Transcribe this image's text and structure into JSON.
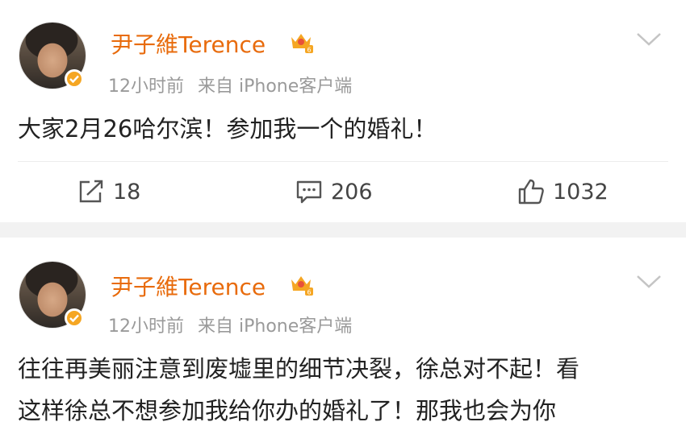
{
  "posts": [
    {
      "author": "尹子維Terence",
      "time": "12小时前",
      "source": "来自 iPhone客户端",
      "content_lines": [
        "大家2月26哈尔滨！参加我一个的婚礼！"
      ],
      "actions": {
        "repost": "18",
        "comment": "206",
        "like": "1032"
      },
      "icons": {
        "repost": "repost-icon",
        "comment": "comment-icon",
        "like": "thumbs-up-icon"
      }
    },
    {
      "author": "尹子維Terence",
      "time": "12小时前",
      "source": "来自 iPhone客户端",
      "content_lines": [
        "往往再美丽注意到废墟里的细节决裂，徐总对不起！看",
        "这样徐总不想参加我给你办的婚礼了！那我也会为你"
      ]
    }
  ],
  "colors": {
    "name": "#e86b0c",
    "meta": "#9a9a9a",
    "badge": "#f5a623",
    "divider": "#f2f2f2"
  }
}
